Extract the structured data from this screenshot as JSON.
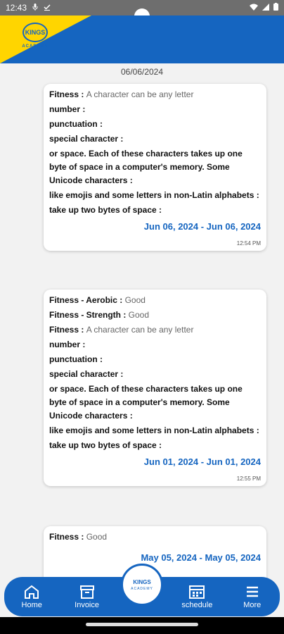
{
  "status": {
    "time": "12:43",
    "mic_icon": "mic-icon",
    "check_icon": "check-icon",
    "wifi_icon": "wifi-icon",
    "signal_icon": "signal-icon",
    "battery_icon": "battery-icon"
  },
  "header": {
    "logo_mark": "KINGS",
    "logo_text": "ACADEMY"
  },
  "date_header": "06/06/2024",
  "cards": [
    {
      "lines": [
        {
          "label": "Fitness : ",
          "value": "A character can be any letter"
        },
        {
          "label": "number :",
          "value": ""
        },
        {
          "label": "punctuation :",
          "value": ""
        },
        {
          "label": "special character :",
          "value": ""
        },
        {
          "label": "or space. Each of these characters takes up one byte of space in a computer's memory. Some Unicode characters :",
          "value": ""
        },
        {
          "label": "like emojis and some letters in non-Latin alphabets :",
          "value": ""
        },
        {
          "label": "take up two bytes of space :",
          "value": ""
        }
      ],
      "range": "Jun 06, 2024 - Jun 06, 2024",
      "time": "12:54 PM"
    },
    {
      "lines": [
        {
          "label": "Fitness - Aerobic : ",
          "value": "Good"
        },
        {
          "label": "Fitness - Strength : ",
          "value": "Good"
        },
        {
          "label": "Fitness : ",
          "value": "A character can be any letter"
        },
        {
          "label": "number :",
          "value": ""
        },
        {
          "label": "punctuation :",
          "value": ""
        },
        {
          "label": "special character :",
          "value": ""
        },
        {
          "label": "or space. Each of these characters takes up one byte of space in a computer's memory. Some Unicode characters :",
          "value": ""
        },
        {
          "label": "like emojis and some letters in non-Latin alphabets :",
          "value": ""
        },
        {
          "label": "take up two bytes of space :",
          "value": ""
        }
      ],
      "range": "Jun 01, 2024 - Jun 01, 2024",
      "time": "12:55 PM"
    },
    {
      "lines": [
        {
          "label": "Fitness : ",
          "value": "Good"
        }
      ],
      "range": "May 05, 2024 - May 05, 2024",
      "time": ""
    }
  ],
  "nav": {
    "home": "Home",
    "invoice": "Invoice",
    "center_mark": "KINGS",
    "center_text": "ACADEMY",
    "schedule": "schedule",
    "more": "More"
  }
}
